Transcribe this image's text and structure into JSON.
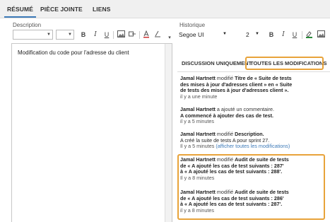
{
  "tabs": [
    "RÉSUMÉ",
    "PIÈCE JOINTE",
    "LIENS"
  ],
  "description": {
    "label": "Description",
    "text": "Modification du code pour l'adresse du client"
  },
  "history": {
    "label": "Historique",
    "font_value": "Segoe UI",
    "size_value": "2",
    "tabs": [
      "DISCUSSION UNIQUEMENT",
      "TOUTES LES MODIFICATIONS"
    ],
    "entries": [
      {
        "who": "Jamal Hartnett",
        "action": " modifié ",
        "lines": [
          "Titre de « Suite de tests",
          "des mises à jour d'adresses client » en « Suite",
          "de tests des mises à jour d'adresses client »."
        ],
        "time": "il y a une minute"
      },
      {
        "who": "Jamal Hartnett",
        "action": " a ajouté un commentaire.",
        "lines": [
          "A commencé à ajouter des cas de test."
        ],
        "time": "il y a 5 minutes"
      },
      {
        "who": "Jamal Hartnett",
        "action": " modifié ",
        "lines": [
          "Description.",
          "A créé la suite de tests A pour sprint 27."
        ],
        "time": "Il y a 5 minutes",
        "link": "(afficher toutes les modifications)"
      },
      {
        "who": "Jamal Hartnett",
        "action": " modifié ",
        "lines": [
          "Audit de suite de tests",
          "de « A ajouté les cas de test suivants : 287'",
          "à « A ajouté les cas de test suivants : 288'."
        ],
        "time": "Il y a 8 minutes"
      },
      {
        "who": "Jamal Hartnett",
        "action": " modifié ",
        "lines": [
          "Audit de suite de tests",
          "de « A ajouté les cas de test suivants : 286'",
          "à « A ajouté les cas de test suivants : 287'."
        ],
        "time": "il y a 8 minutes"
      }
    ]
  },
  "colors": {
    "accent": "#3d7ab8",
    "highlight": "#e8a33a"
  }
}
